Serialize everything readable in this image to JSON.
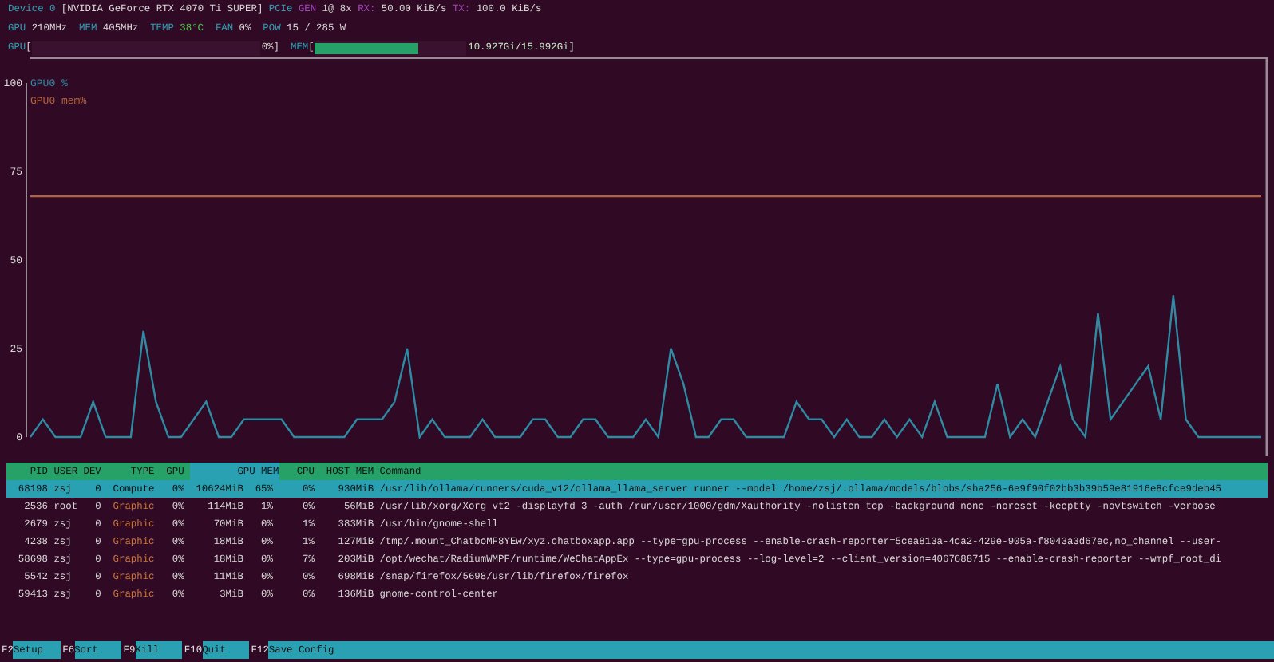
{
  "device_line": {
    "device": "Device 0",
    "name": "[NVIDIA GeForce RTX 4070 Ti SUPER]",
    "pcie_label": "PCIe",
    "gen_label": "GEN",
    "gen_value": "1@ 8x",
    "rx_label": "RX:",
    "rx_value": "50.00 KiB/s",
    "tx_label": "TX:",
    "tx_value": "100.0 KiB/s"
  },
  "clock_line": [
    {
      "label": "GPU",
      "value": "210MHz",
      "kind": "plain"
    },
    {
      "label": "MEM",
      "value": "405MHz",
      "kind": "plain"
    },
    {
      "label": "TEMP",
      "value": "38°C",
      "kind": "temp"
    },
    {
      "label": "FAN",
      "value": "0%",
      "kind": "plain"
    },
    {
      "label": "POW",
      "value": "15 / 285 W",
      "kind": "plain"
    }
  ],
  "gpu_bar": {
    "label": "GPU",
    "open": "[",
    "reading": "0%",
    "close": "]",
    "level": 0
  },
  "mem_bar": {
    "label": "MEM",
    "open": "[",
    "reading": "10.927Gi/15.992Gi",
    "close": "]",
    "level": 0.68
  },
  "chart": {
    "chart_data": {
      "type": "line",
      "ylim": [
        0,
        100
      ],
      "yticks": [
        0,
        25,
        50,
        75,
        100
      ],
      "series": [
        {
          "name": "GPU0 %",
          "color": "#2e8ba3",
          "values": [
            0,
            5,
            0,
            0,
            0,
            10,
            0,
            0,
            0,
            30,
            10,
            0,
            0,
            5,
            10,
            0,
            0,
            5,
            5,
            5,
            5,
            0,
            0,
            0,
            0,
            0,
            5,
            5,
            5,
            10,
            25,
            0,
            5,
            0,
            0,
            0,
            5,
            0,
            0,
            0,
            5,
            5,
            0,
            0,
            5,
            5,
            0,
            0,
            0,
            5,
            0,
            25,
            15,
            0,
            0,
            5,
            5,
            0,
            0,
            0,
            0,
            10,
            5,
            5,
            0,
            5,
            0,
            0,
            5,
            0,
            5,
            0,
            10,
            0,
            0,
            0,
            0,
            15,
            0,
            5,
            0,
            10,
            20,
            5,
            0,
            35,
            5,
            10,
            15,
            20,
            5,
            40,
            5,
            0,
            0,
            0,
            0,
            0,
            0
          ]
        },
        {
          "name": "GPU0 mem%",
          "color": "#b4643c",
          "values": [
            68,
            68,
            68,
            68,
            68,
            68,
            68,
            68,
            68,
            68,
            68,
            68,
            68,
            68,
            68,
            68,
            68,
            68,
            68,
            68,
            68,
            68,
            68,
            68,
            68,
            68,
            68,
            68,
            68,
            68,
            68,
            68,
            68,
            68,
            68,
            68,
            68,
            68,
            68,
            68,
            68,
            68,
            68,
            68,
            68,
            68,
            68,
            68,
            68,
            68,
            68,
            68,
            68,
            68,
            68,
            68,
            68,
            68,
            68,
            68,
            68,
            68,
            68,
            68,
            68,
            68,
            68,
            68,
            68,
            68,
            68,
            68,
            68,
            68,
            68,
            68,
            68,
            68,
            68,
            68,
            68,
            68,
            68,
            68,
            68,
            68,
            68,
            68,
            68,
            68,
            68,
            68,
            68,
            68,
            68,
            68,
            68,
            68,
            68
          ]
        }
      ]
    }
  },
  "process_table": {
    "columns": [
      {
        "label": "PID",
        "selected": false
      },
      {
        "label": "USER",
        "selected": false
      },
      {
        "label": "DEV",
        "selected": false
      },
      {
        "label": "TYPE",
        "selected": false
      },
      {
        "label": "GPU",
        "selected": false
      },
      {
        "label": "GPU MEM",
        "selected": true
      },
      {
        "label": "CPU",
        "selected": false
      },
      {
        "label": "HOST MEM",
        "selected": false
      },
      {
        "label": "Command",
        "selected": false
      }
    ],
    "rows": [
      {
        "selected": true,
        "pid": "68198",
        "user": "zsj",
        "dev": "0",
        "type": "Compute",
        "kind": "compute",
        "gpu": "0%",
        "gpu_mem": "10624MiB",
        "gpu_mem_pct": "65%",
        "cpu": "0%",
        "host_mem": "930MiB",
        "command": "/usr/lib/ollama/runners/cuda_v12/ollama_llama_server runner --model /home/zsj/.ollama/models/blobs/sha256-6e9f90f02bb3b39b59e81916e8cfce9deb45"
      },
      {
        "selected": false,
        "pid": "2536",
        "user": "root",
        "dev": "0",
        "type": "Graphic",
        "kind": "graphic",
        "gpu": "0%",
        "gpu_mem": "114MiB",
        "gpu_mem_pct": "1%",
        "cpu": "0%",
        "host_mem": "56MiB",
        "command": "/usr/lib/xorg/Xorg vt2 -displayfd 3 -auth /run/user/1000/gdm/Xauthority -nolisten tcp -background none -noreset -keeptty -novtswitch -verbose"
      },
      {
        "selected": false,
        "pid": "2679",
        "user": "zsj",
        "dev": "0",
        "type": "Graphic",
        "kind": "graphic",
        "gpu": "0%",
        "gpu_mem": "70MiB",
        "gpu_mem_pct": "0%",
        "cpu": "1%",
        "host_mem": "383MiB",
        "command": "/usr/bin/gnome-shell"
      },
      {
        "selected": false,
        "pid": "4238",
        "user": "zsj",
        "dev": "0",
        "type": "Graphic",
        "kind": "graphic",
        "gpu": "0%",
        "gpu_mem": "18MiB",
        "gpu_mem_pct": "0%",
        "cpu": "1%",
        "host_mem": "127MiB",
        "command": "/tmp/.mount_ChatboMF8YEw/xyz.chatboxapp.app --type=gpu-process --enable-crash-reporter=5cea813a-4ca2-429e-905a-f8043a3d67ec,no_channel --user-"
      },
      {
        "selected": false,
        "pid": "58698",
        "user": "zsj",
        "dev": "0",
        "type": "Graphic",
        "kind": "graphic",
        "gpu": "0%",
        "gpu_mem": "18MiB",
        "gpu_mem_pct": "0%",
        "cpu": "7%",
        "host_mem": "203MiB",
        "command": "/opt/wechat/RadiumWMPF/runtime/WeChatAppEx --type=gpu-process --log-level=2 --client_version=4067688715 --enable-crash-reporter --wmpf_root_di"
      },
      {
        "selected": false,
        "pid": "5542",
        "user": "zsj",
        "dev": "0",
        "type": "Graphic",
        "kind": "graphic",
        "gpu": "0%",
        "gpu_mem": "11MiB",
        "gpu_mem_pct": "0%",
        "cpu": "0%",
        "host_mem": "698MiB",
        "command": "/snap/firefox/5698/usr/lib/firefox/firefox"
      },
      {
        "selected": false,
        "pid": "59413",
        "user": "zsj",
        "dev": "0",
        "type": "Graphic",
        "kind": "graphic",
        "gpu": "0%",
        "gpu_mem": "3MiB",
        "gpu_mem_pct": "0%",
        "cpu": "0%",
        "host_mem": "136MiB",
        "command": "gnome-control-center"
      }
    ]
  },
  "function_keys": [
    {
      "key": "F2",
      "label": "Setup"
    },
    {
      "key": "F6",
      "label": "Sort"
    },
    {
      "key": "F9",
      "label": "Kill"
    },
    {
      "key": "F10",
      "label": "Quit"
    },
    {
      "key": "F12",
      "label": "Save Config"
    }
  ]
}
